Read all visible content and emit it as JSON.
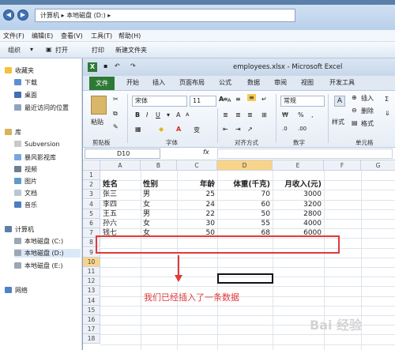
{
  "explorer": {
    "address": [
      "计算机",
      "本地磁盘 (D:)"
    ],
    "menu": [
      "文件(F)",
      "编辑(E)",
      "查看(V)",
      "工具(T)",
      "帮助(H)"
    ],
    "toolbar": [
      "组织",
      "打开",
      "打印",
      "新建文件夹"
    ],
    "nav": {
      "favorites": "收藏夹",
      "fav_items": [
        "下载",
        "桌面",
        "最近访问的位置"
      ],
      "library": "库",
      "lib_items": [
        "Subversion",
        "暴风影视库",
        "视频",
        "图片",
        "文档",
        "音乐"
      ],
      "computer": "计算机",
      "drives": [
        "本地磁盘 (C:)",
        "本地磁盘 (D:)",
        "本地磁盘 (E:)"
      ],
      "network": "网络"
    }
  },
  "excel": {
    "title": "employees.xlsx - Microsoft Excel",
    "tabs": [
      "文件",
      "开始",
      "插入",
      "页面布局",
      "公式",
      "数据",
      "审阅",
      "视图",
      "开发工具"
    ],
    "ribbon": {
      "paste": "粘贴",
      "font": "宋体",
      "size": "11",
      "number_format": "常规",
      "style": "样式",
      "insert": "插入",
      "delete": "删除",
      "format": "格式",
      "groups": [
        "剪贴板",
        "字体",
        "对齐方式",
        "数字",
        "单元格"
      ]
    },
    "namebox": "D10",
    "fx": "fx",
    "columns": [
      "A",
      "B",
      "C",
      "D",
      "E",
      "F",
      "G"
    ],
    "rows": [
      "1",
      "2",
      "3",
      "4",
      "5",
      "6",
      "7",
      "8",
      "9",
      "10",
      "11",
      "12",
      "13",
      "14",
      "15",
      "16",
      "17",
      "18"
    ],
    "headers": [
      "姓名",
      "性别",
      "年龄",
      "体重(千克)",
      "月收入(元)"
    ],
    "data": [
      [
        "张三",
        "男",
        "25",
        "70",
        "3000"
      ],
      [
        "李四",
        "女",
        "24",
        "60",
        "3200"
      ],
      [
        "王五",
        "男",
        "22",
        "50",
        "2800"
      ],
      [
        "孙六",
        "女",
        "30",
        "55",
        "4000"
      ],
      [
        "钱七",
        "女",
        "50",
        "68",
        "6000"
      ]
    ]
  },
  "annotation": "我们已经插入了一条数据",
  "watermark": "Bai 经验",
  "colors": {
    "accent": "#2d7a35",
    "annotation": "#e03a3a"
  }
}
